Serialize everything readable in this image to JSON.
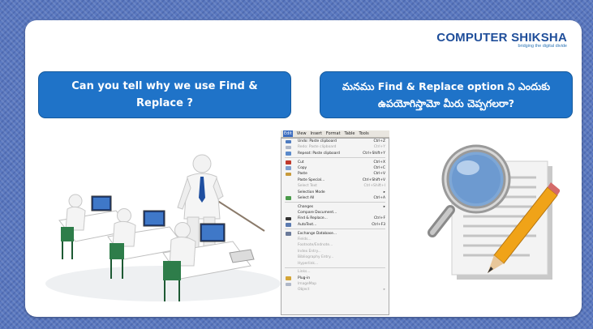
{
  "logo": {
    "main": "COMPUTER SHIKSHA",
    "tagline": "bridging the digital divide"
  },
  "questions": {
    "english": "Can you tell why we use Find & Replace ?",
    "telugu": "మనము Find & Replace option ని ఎందుకు ఉపయోగిస్తామో మీరు చెప్పగలరా?"
  },
  "menu_screenshot": {
    "menubar": [
      "Edit",
      "View",
      "Insert",
      "Format",
      "Table",
      "Tools"
    ],
    "items": [
      {
        "label": "Undo: Paste clipboard",
        "shortcut": "Ctrl+Z",
        "icon": "undo-icon",
        "color": "#4d7bc0"
      },
      {
        "label": "Redo: Paste clipboard",
        "shortcut": "Ctrl+Y",
        "icon": "redo-icon",
        "color": "#b0b8c8",
        "disabled": true
      },
      {
        "label": "Repeat: Paste clipboard",
        "shortcut": "Ctrl+Shift+Y",
        "icon": "repeat-icon",
        "color": "#5a8acb"
      },
      {
        "sep": true
      },
      {
        "label": "Cut",
        "shortcut": "Ctrl+X",
        "icon": "cut-icon",
        "color": "#c0392b"
      },
      {
        "label": "Copy",
        "shortcut": "Ctrl+C",
        "icon": "copy-icon",
        "color": "#7f9fcf"
      },
      {
        "label": "Paste",
        "shortcut": "Ctrl+V",
        "icon": "paste-icon",
        "color": "#c89a3a"
      },
      {
        "label": "Paste Special...",
        "shortcut": "Ctrl+Shift+V"
      },
      {
        "label": "Select Text",
        "shortcut": "Ctrl+Shift+I",
        "disabled": true
      },
      {
        "label": "Selection Mode",
        "shortcut": "▸"
      },
      {
        "label": "Select All",
        "shortcut": "Ctrl+A",
        "icon": "select-all-icon",
        "color": "#4a9a4a"
      },
      {
        "sep": true
      },
      {
        "label": "Changes",
        "shortcut": "▸"
      },
      {
        "label": "Compare Document..."
      },
      {
        "label": "Find & Replace...",
        "shortcut": "Ctrl+F",
        "icon": "binoculars-icon",
        "color": "#333333"
      },
      {
        "label": "AutoText...",
        "shortcut": "Ctrl+F3",
        "icon": "autotext-icon",
        "color": "#5a7ab0"
      },
      {
        "sep": true
      },
      {
        "label": "Exchange Database...",
        "icon": "database-icon",
        "color": "#6a7a9a"
      },
      {
        "label": "Fields...",
        "disabled": true
      },
      {
        "label": "Footnote/Endnote...",
        "disabled": true
      },
      {
        "label": "Index Entry...",
        "disabled": true
      },
      {
        "label": "Bibliography Entry...",
        "disabled": true
      },
      {
        "label": "Hyperlink...",
        "disabled": true
      },
      {
        "sep": true
      },
      {
        "label": "Links...",
        "disabled": true
      },
      {
        "label": "Plug-in",
        "icon": "plugin-icon",
        "color": "#d4a537"
      },
      {
        "label": "ImageMap",
        "icon": "imagemap-icon",
        "color": "#b0b8c8",
        "disabled": true
      },
      {
        "label": "Object",
        "shortcut": "▸",
        "disabled": true
      }
    ]
  }
}
